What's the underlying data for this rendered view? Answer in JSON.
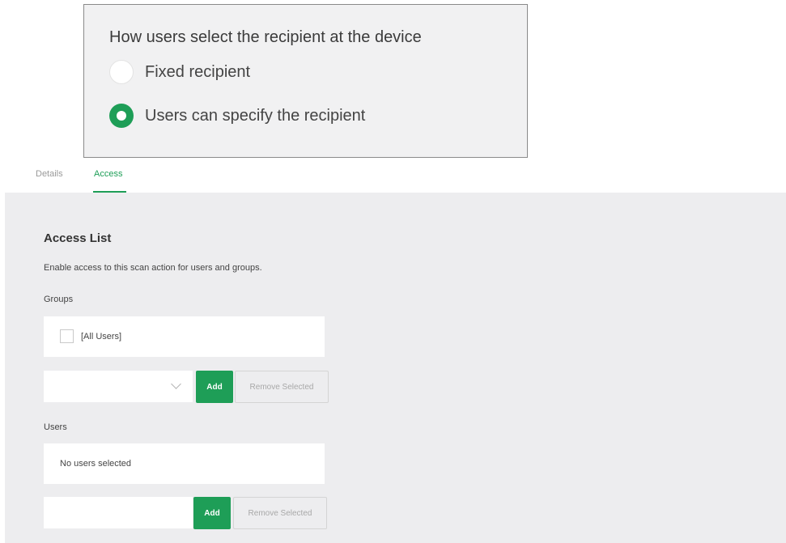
{
  "recipient": {
    "title": "How users select the recipient at the device",
    "options": [
      {
        "label": "Fixed recipient",
        "selected": false
      },
      {
        "label": "Users can specify the recipient",
        "selected": true
      }
    ]
  },
  "tabs": [
    {
      "label": "Details",
      "active": false
    },
    {
      "label": "Access",
      "active": true
    }
  ],
  "access": {
    "title": "Access List",
    "description": "Enable access to this scan action for users and groups.",
    "groups": {
      "label": "Groups",
      "items": [
        {
          "label": "[All Users]",
          "checked": false
        }
      ],
      "select_value": "",
      "add_label": "Add",
      "remove_label": "Remove Selected"
    },
    "users": {
      "label": "Users",
      "empty_text": "No users selected",
      "input_value": "",
      "add_label": "Add",
      "remove_label": "Remove Selected"
    }
  },
  "colors": {
    "accent": "#1e9e57",
    "panel_bg": "#ededef",
    "callout_bg": "#f1f1f2"
  },
  "icons": {
    "select_chevron": "chevron-down-icon"
  }
}
